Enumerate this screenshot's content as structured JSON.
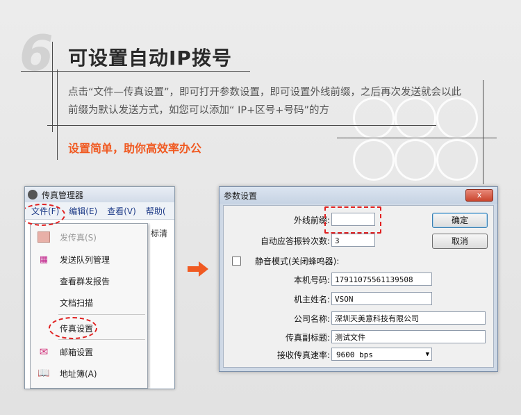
{
  "header": {
    "number": "6",
    "title": "可设置自动IP拨号",
    "description": "点击“文件—传真设置”，即可打开参数设置，即可设置外线前缀，之后再次发送就会以此前缀为默认发送方式，如您可以添加“ IP+区号+号码”的方",
    "subtitle": "设置简单，助你高效率办公"
  },
  "left_window": {
    "title": "传真管理器",
    "menu": [
      "文件(F)",
      "编辑(E)",
      "查看(V)",
      "帮助("
    ],
    "side_text": "标清",
    "dropdown": [
      {
        "label": "发传真(S)",
        "icon": "fax-send-icon",
        "disabled": true
      },
      {
        "label": "发送队列管理",
        "icon": "queue-grid-icon",
        "disabled": false
      },
      {
        "label": "查看群发报告",
        "icon": "",
        "disabled": false
      },
      {
        "label": "文档扫描",
        "icon": "",
        "disabled": false
      },
      {
        "label": "传真设置",
        "icon": "",
        "disabled": false
      },
      {
        "label": "邮箱设置",
        "icon": "mail-icon",
        "disabled": false
      },
      {
        "label": "地址簿(A)",
        "icon": "address-book-icon",
        "disabled": false
      }
    ]
  },
  "dialog": {
    "title": "参数设置",
    "close_label": "x",
    "ok_label": "确定",
    "cancel_label": "取消",
    "fields": {
      "prefix_label": "外线前缀:",
      "prefix_value": "",
      "rings_label": "自动应答振铃次数:",
      "rings_value": "3",
      "mute_label": "静音模式(关闭蜂鸣器):",
      "number_label": "本机号码:",
      "number_value": "17911075561139508",
      "name_label": "机主姓名:",
      "name_value": "VSON",
      "company_label": "公司名称:",
      "company_value": "深圳天美意科技有限公司",
      "subtitle_label": "传真副标题:",
      "subtitle_value": "测试文件",
      "speed_label": "接收传真速率:",
      "speed_value": "9600 bps"
    }
  },
  "colors": {
    "accent": "#f05a22",
    "highlight_oval": "#e02020"
  }
}
